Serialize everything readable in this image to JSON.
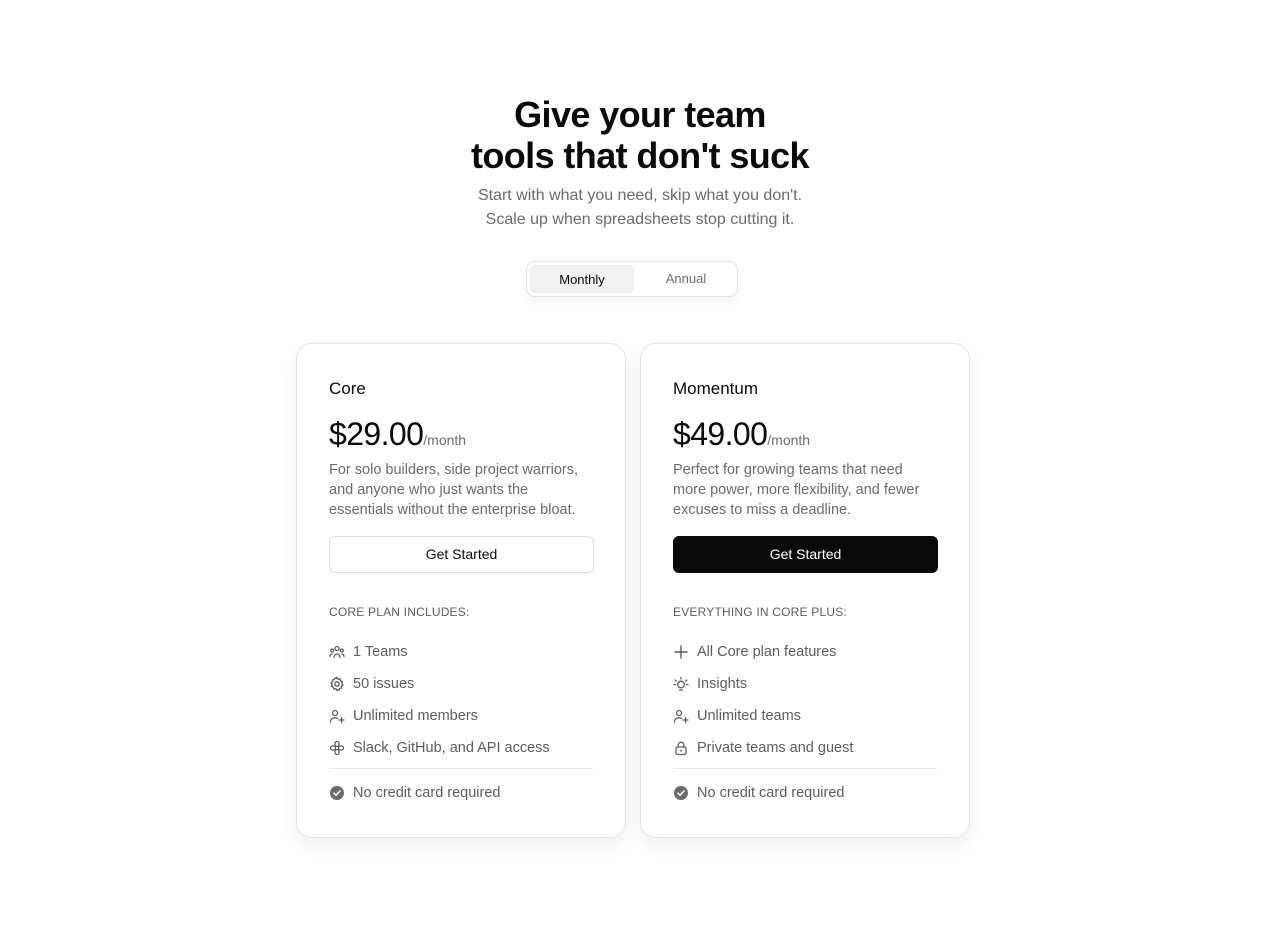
{
  "hero": {
    "title_line1": "Give your team",
    "title_line2": "tools that don't suck",
    "subtitle_line1": "Start with what you need, skip what you don't.",
    "subtitle_line2": "Scale up when spreadsheets stop cutting it."
  },
  "billing_toggle": {
    "options": [
      "Monthly",
      "Annual"
    ],
    "selected": "Monthly"
  },
  "plans": [
    {
      "name": "Core",
      "price": "$29.00",
      "period": "/month",
      "description": "For solo builders, side project warriors, and anyone who just wants the essentials without the enterprise bloat.",
      "cta_label": "Get Started",
      "cta_style": "outline",
      "includes_heading": "CORE PLAN INCLUDES:",
      "features": [
        {
          "icon": "teams-icon",
          "label": "1 Teams"
        },
        {
          "icon": "gear-icon",
          "label": "50 issues"
        },
        {
          "icon": "user-plus-icon",
          "label": "Unlimited members"
        },
        {
          "icon": "integrations-icon",
          "label": "Slack, GitHub, and API access"
        }
      ],
      "note": "No credit card required"
    },
    {
      "name": "Momentum",
      "price": "$49.00",
      "period": "/month",
      "description": "Perfect for growing teams that need more power, more flexibility, and fewer excuses to miss a deadline.",
      "cta_label": "Get Started",
      "cta_style": "solid",
      "includes_heading": "EVERYTHING IN CORE PLUS:",
      "features": [
        {
          "icon": "plus-icon",
          "label": "All Core plan features"
        },
        {
          "icon": "lightbulb-icon",
          "label": "Insights"
        },
        {
          "icon": "user-plus-icon",
          "label": "Unlimited teams"
        },
        {
          "icon": "lock-icon",
          "label": "Private teams and guest"
        }
      ],
      "note": "No credit card required"
    }
  ],
  "colors": {
    "text_primary": "#0a0a0a",
    "text_muted": "#6b6b6b",
    "border": "#e4e4e4",
    "cta_solid_bg": "#0a0a0a"
  }
}
